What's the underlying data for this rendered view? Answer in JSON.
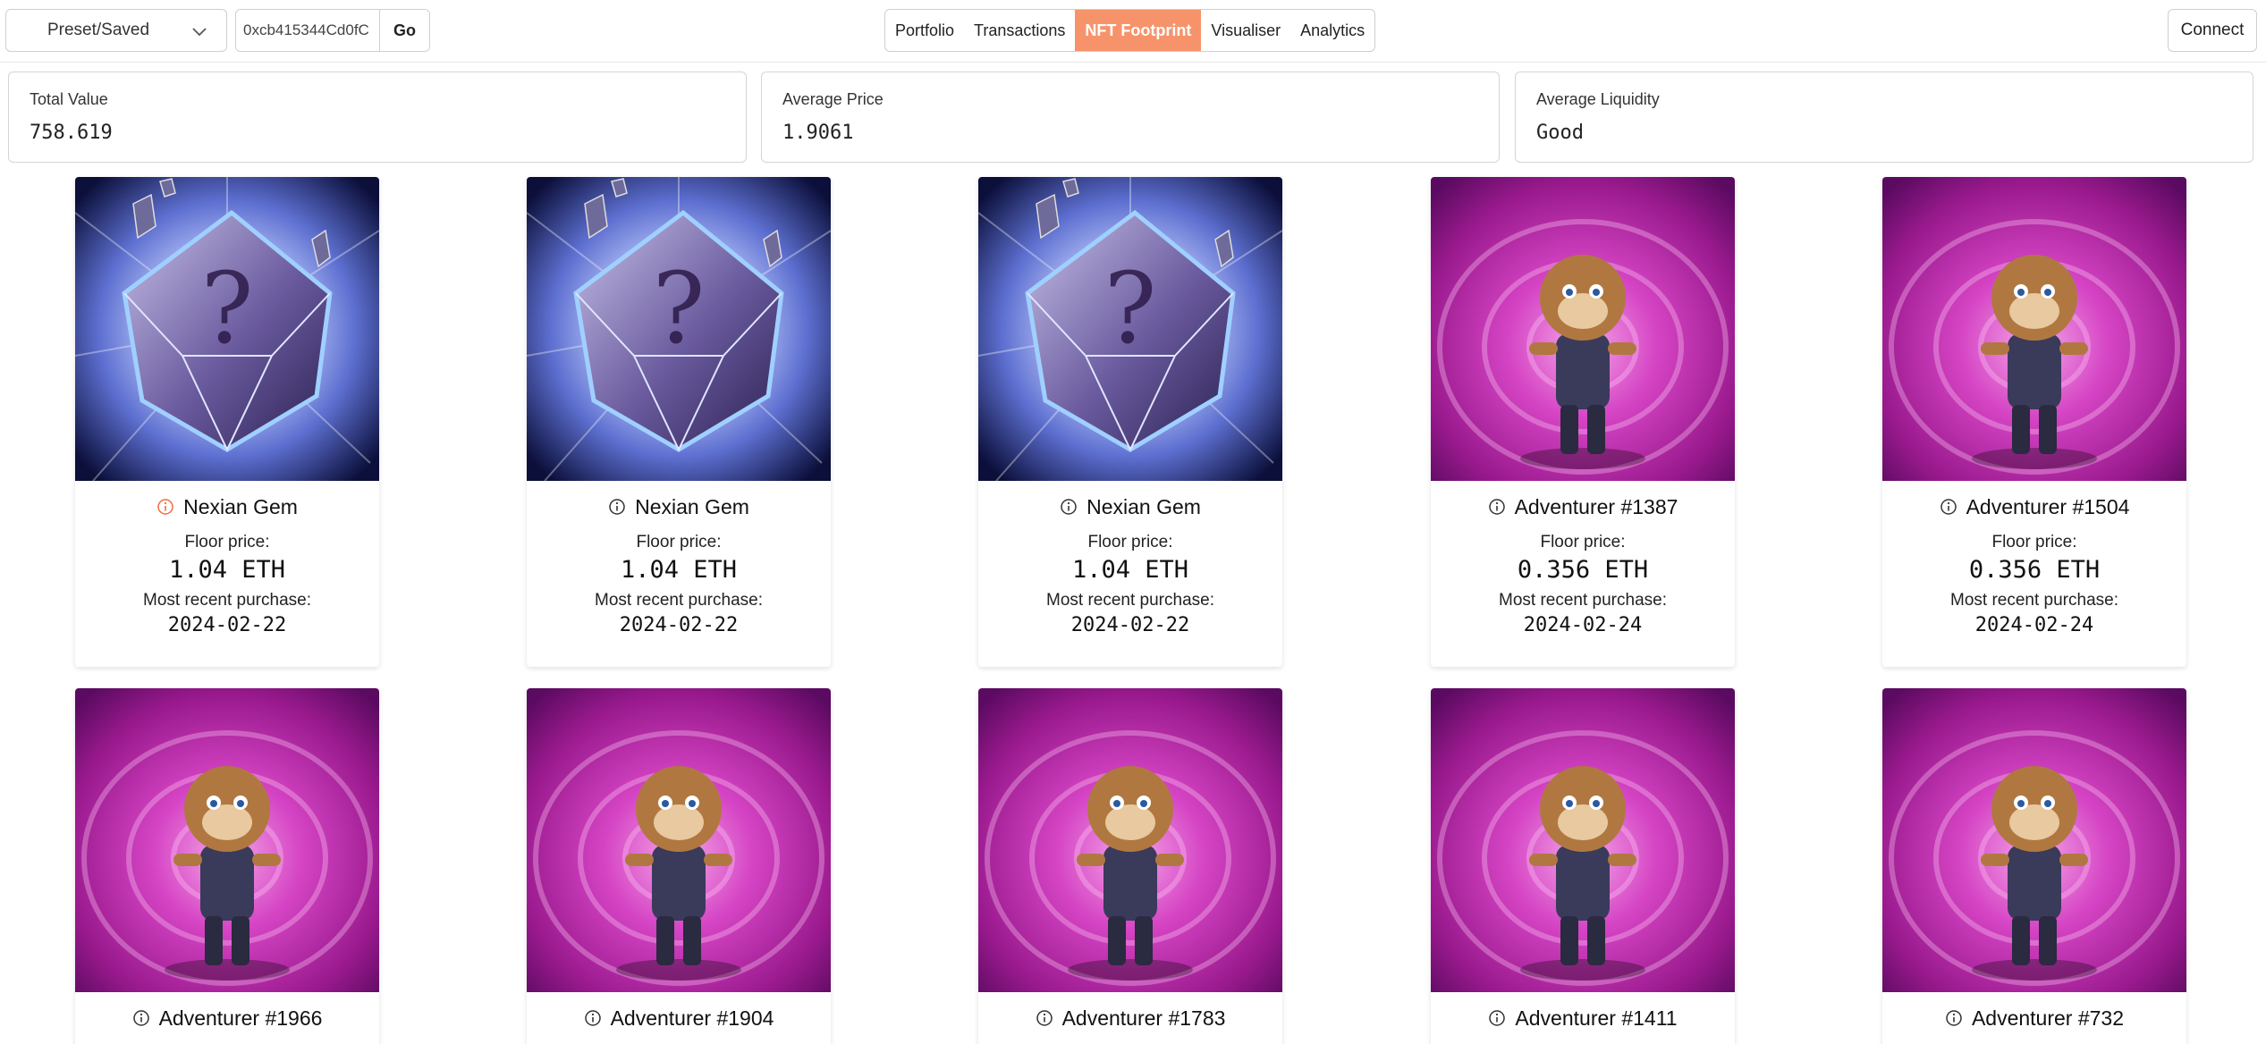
{
  "toolbar": {
    "preset_label": "Preset/Saved",
    "address_value": "0xcb415344Cd0fC",
    "go_label": "Go",
    "connect_label": "Connect"
  },
  "tabs": [
    {
      "label": "Portfolio",
      "active": false
    },
    {
      "label": "Transactions",
      "active": false
    },
    {
      "label": "NFT Footprint",
      "active": true
    },
    {
      "label": "Visualiser",
      "active": false
    },
    {
      "label": "Analytics",
      "active": false
    }
  ],
  "stats": [
    {
      "label": "Total Value",
      "value": "758.619"
    },
    {
      "label": "Average Price",
      "value": "1.9061"
    },
    {
      "label": "Average Liquidity",
      "value": "Good"
    }
  ],
  "labels": {
    "floor": "Floor price:",
    "recent": "Most recent purchase:"
  },
  "nfts": [
    {
      "name": "Nexian Gem",
      "kind": "gem",
      "info_color": "#f26b3a",
      "floor": "1.04 ETH",
      "recent": "2024-02-22"
    },
    {
      "name": "Nexian Gem",
      "kind": "gem",
      "info_color": "#333333",
      "floor": "1.04 ETH",
      "recent": "2024-02-22"
    },
    {
      "name": "Nexian Gem",
      "kind": "gem",
      "info_color": "#333333",
      "floor": "1.04 ETH",
      "recent": "2024-02-22"
    },
    {
      "name": "Adventurer #1387",
      "kind": "adventurer",
      "info_color": "#333333",
      "floor": "0.356 ETH",
      "recent": "2024-02-24"
    },
    {
      "name": "Adventurer #1504",
      "kind": "adventurer",
      "info_color": "#333333",
      "floor": "0.356 ETH",
      "recent": "2024-02-24"
    },
    {
      "name": "Adventurer #1966",
      "kind": "adventurer",
      "info_color": "#333333"
    },
    {
      "name": "Adventurer #1904",
      "kind": "adventurer",
      "info_color": "#333333"
    },
    {
      "name": "Adventurer #1783",
      "kind": "adventurer",
      "info_color": "#333333"
    },
    {
      "name": "Adventurer #1411",
      "kind": "adventurer",
      "info_color": "#333333"
    },
    {
      "name": "Adventurer #732",
      "kind": "adventurer",
      "info_color": "#333333"
    }
  ],
  "colors": {
    "accent": "#f7936a",
    "adventurer_bg": "#b0209a",
    "gem_bg": "#8fa6e8"
  }
}
